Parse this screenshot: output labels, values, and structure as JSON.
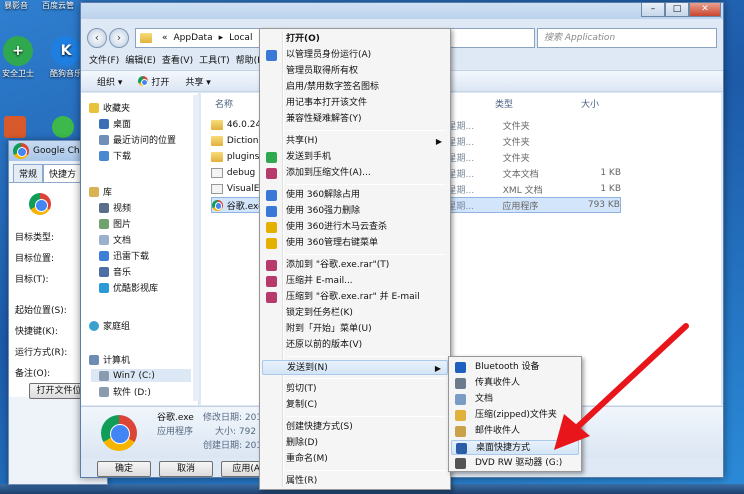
{
  "desktop": {
    "top_labels": [
      "暴影音",
      "百度云管"
    ],
    "icons": [
      {
        "label": "安全卫士",
        "color": "#2fa84f",
        "glyph": "+"
      },
      {
        "label": "酷狗音乐",
        "color": "#1f7fe0",
        "glyph": "K"
      }
    ]
  },
  "properties": {
    "title": "Google Chro",
    "tabs": [
      "常规",
      "快捷方"
    ],
    "rows": [
      "目标类型:",
      "目标位置:",
      "目标(T):",
      "起始位置(S):",
      "快捷键(K):",
      "运行方式(R):",
      "备注(O):"
    ],
    "open_file_button": "打开文件位"
  },
  "explorer": {
    "address_path": [
      "«",
      "AppData",
      "Local"
    ],
    "search_placeholder": "搜索 Application",
    "window_buttons": [
      "–",
      "□",
      "✕"
    ],
    "menu": [
      "文件(F)",
      "编辑(E)",
      "查看(V)",
      "工具(T)",
      "帮助(H)"
    ],
    "toolbar": [
      "组织 ▾",
      "打开",
      "共享 ▾"
    ],
    "nav": {
      "favorites_header": "收藏夹",
      "favorites": [
        "桌面",
        "最近访问的位置",
        "下载"
      ],
      "library_header": "库",
      "library": [
        "视频",
        "图片",
        "文档",
        "迅雷下载",
        "音乐",
        "优酷影视库"
      ],
      "homegroup": "家庭组",
      "computer_header": "计算机",
      "drives": [
        "Win7 (C:)",
        "软件 (D:)"
      ]
    },
    "columns": {
      "name": "名称",
      "type": "类型",
      "size": "大小"
    },
    "files": [
      {
        "name": "46.0.24",
        "date": "星期...",
        "type": "文件夹",
        "size": "",
        "kind": "folder"
      },
      {
        "name": "Diction",
        "date": "星期...",
        "type": "文件夹",
        "size": "",
        "kind": "folder"
      },
      {
        "name": "plugins",
        "date": "星期...",
        "type": "文件夹",
        "size": "",
        "kind": "folder"
      },
      {
        "name": "debug",
        "date": "星期...",
        "type": "文本文档",
        "size": "1 KB",
        "kind": "doc"
      },
      {
        "name": "VisualE",
        "date": "星期...",
        "type": "XML 文档",
        "size": "1 KB",
        "kind": "doc"
      },
      {
        "name": "谷歌.exe",
        "date": "星期...",
        "type": "应用程序",
        "size": "793 KB",
        "kind": "exe"
      }
    ],
    "details": {
      "filename": "谷歌.exe",
      "modified_label": "修改日期: 2015",
      "kind": "应用程序",
      "size_label": "大小: 792",
      "created_label": "创建日期: 2015"
    },
    "dialog_buttons": [
      "确定",
      "取消",
      "应用(A)"
    ]
  },
  "context_menu": {
    "items": [
      {
        "label": "打开(O)",
        "bold": true,
        "icon": ""
      },
      {
        "label": "以管理员身份运行(A)",
        "icon": "#3a78d8"
      },
      {
        "label": "管理员取得所有权",
        "icon": ""
      },
      {
        "label": "启用/禁用数字签名图标",
        "icon": ""
      },
      {
        "label": "用记事本打开该文件",
        "icon": ""
      },
      {
        "label": "兼容性疑难解答(Y)",
        "icon": ""
      },
      {
        "sep": true
      },
      {
        "label": "共享(H)",
        "submenu": true,
        "icon": ""
      },
      {
        "label": "发送到手机",
        "icon": "#2fa84f"
      },
      {
        "label": "添加到压缩文件(A)...",
        "icon": "#b63a6b"
      },
      {
        "sep": true
      },
      {
        "label": "使用 360解除占用",
        "icon": "#3a78d8"
      },
      {
        "label": "使用 360强力删除",
        "icon": "#3a78d8"
      },
      {
        "label": "使用 360进行木马云查杀",
        "icon": "#e5b000"
      },
      {
        "label": "使用 360管理右键菜单",
        "icon": "#e5b000"
      },
      {
        "sep": true
      },
      {
        "label": "添加到 \"谷歌.exe.rar\"(T)",
        "icon": "#b63a6b"
      },
      {
        "label": "压缩并 E-mail...",
        "icon": "#b63a6b"
      },
      {
        "label": "压缩到 \"谷歌.exe.rar\" 并 E-mail",
        "icon": "#b63a6b"
      },
      {
        "label": "锁定到任务栏(K)",
        "icon": ""
      },
      {
        "label": "附到「开始」菜单(U)",
        "icon": ""
      },
      {
        "label": "还原以前的版本(V)",
        "icon": ""
      },
      {
        "sep": true
      },
      {
        "label": "发送到(N)",
        "submenu": true,
        "highlighted": true,
        "icon": ""
      },
      {
        "sep": true
      },
      {
        "label": "剪切(T)",
        "icon": ""
      },
      {
        "label": "复制(C)",
        "icon": ""
      },
      {
        "sep": true
      },
      {
        "label": "创建快捷方式(S)",
        "icon": ""
      },
      {
        "label": "删除(D)",
        "icon": ""
      },
      {
        "label": "重命名(M)",
        "icon": ""
      },
      {
        "sep": true
      },
      {
        "label": "属性(R)",
        "icon": ""
      }
    ]
  },
  "sendto_menu": {
    "items": [
      {
        "label": "Bluetooth 设备",
        "icon": "#1f5fbf"
      },
      {
        "label": "传真收件人",
        "icon": "#6b7b8c"
      },
      {
        "label": "文档",
        "icon": "#7a9cc4"
      },
      {
        "label": "压缩(zipped)文件夹",
        "icon": "#e0b23c"
      },
      {
        "label": "邮件收件人",
        "icon": "#c9a24a"
      },
      {
        "label": "桌面快捷方式",
        "icon": "#2b5ea8",
        "highlighted": true
      },
      {
        "label": "DVD RW 驱动器 (G:)",
        "icon": "#555555"
      }
    ]
  },
  "colors": {
    "annotation_arrow": "#e8161b",
    "highlight": "#d4e5f7"
  }
}
